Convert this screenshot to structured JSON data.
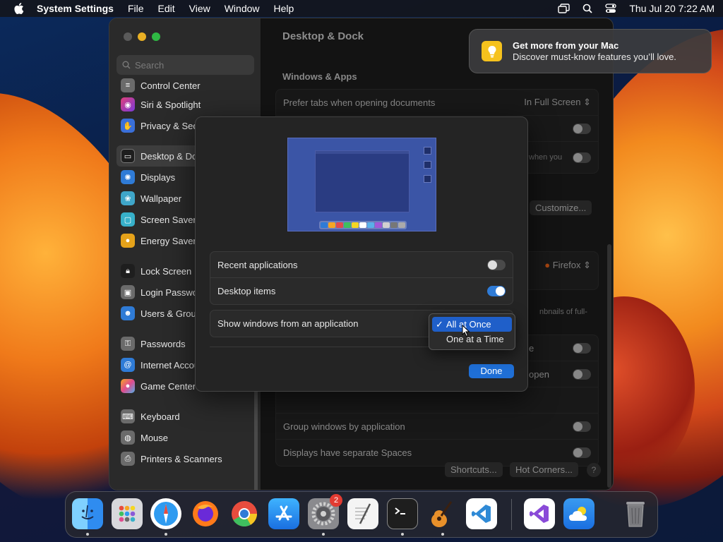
{
  "menubar": {
    "app_name": "System Settings",
    "items": [
      "File",
      "Edit",
      "View",
      "Window",
      "Help"
    ],
    "clock": "Thu Jul 20  7:22 AM"
  },
  "sidebar": {
    "search_placeholder": "Search",
    "items": [
      {
        "label": "Control Center",
        "icon": "control-center-icon",
        "color": "#6b6b6b"
      },
      {
        "label": "Siri & Spotlight",
        "icon": "siri-icon",
        "color": "#c0307a"
      },
      {
        "label": "Privacy & Security",
        "icon": "hand-icon",
        "color": "#3a6fd8"
      },
      {
        "label": "Desktop & Dock",
        "icon": "dock-icon",
        "color": "#1e1e1e"
      },
      {
        "label": "Displays",
        "icon": "sun-icon",
        "color": "#2f7bd6"
      },
      {
        "label": "Wallpaper",
        "icon": "flower-icon",
        "color": "#3fa6c9"
      },
      {
        "label": "Screen Saver",
        "icon": "screen-saver-icon",
        "color": "#37b0c9"
      },
      {
        "label": "Energy Saver",
        "icon": "bulb-icon",
        "color": "#e5a21a"
      },
      {
        "label": "Lock Screen",
        "icon": "lock-icon",
        "color": "#1e1e1e"
      },
      {
        "label": "Login Password",
        "icon": "lock-icon",
        "color": "#6b6b6b"
      },
      {
        "label": "Users & Groups",
        "icon": "users-icon",
        "color": "#2f7bd6"
      },
      {
        "label": "Passwords",
        "icon": "key-icon",
        "color": "#6b6b6b"
      },
      {
        "label": "Internet Accounts",
        "icon": "at-icon",
        "color": "#2f7bd6"
      },
      {
        "label": "Game Center",
        "icon": "game-center-icon",
        "color": "#e04c8e"
      },
      {
        "label": "Keyboard",
        "icon": "keyboard-icon",
        "color": "#6b6b6b"
      },
      {
        "label": "Mouse",
        "icon": "mouse-icon",
        "color": "#6b6b6b"
      },
      {
        "label": "Printers & Scanners",
        "icon": "printer-icon",
        "color": "#6b6b6b"
      }
    ]
  },
  "main": {
    "title": "Desktop & Dock",
    "section": "Windows & Apps",
    "prefer_tabs_label": "Prefer tabs when opening documents",
    "prefer_tabs_value": "In Full Screen",
    "when_you_fragment": "when you",
    "customize_label": "Customize...",
    "browser_value": "Firefox",
    "thumbnails_fragment": "nbnails of full-",
    "e_fragment": "e",
    "open_fragment": "open",
    "group_windows_label": "Group windows by application",
    "separate_spaces_label": "Displays have separate Spaces",
    "shortcuts_label": "Shortcuts...",
    "hot_corners_label": "Hot Corners...",
    "help_label": "?"
  },
  "sheet": {
    "recent_apps_label": "Recent applications",
    "desktop_items_label": "Desktop items",
    "show_windows_label": "Show windows from an application",
    "done_label": "Done",
    "options": [
      "All at Once",
      "One at a Time"
    ],
    "selected_option": "All at Once",
    "check_mark": "✓"
  },
  "notification": {
    "title": "Get more from your Mac",
    "body": "Discover must-know features you’ll love."
  },
  "dock": {
    "apps": [
      "Finder",
      "Launchpad",
      "Safari",
      "Firefox",
      "Chrome",
      "App Store",
      "System Settings",
      "TextEdit",
      "Terminal",
      "GarageBand",
      "Visual Studio Code",
      "Visual Studio",
      "Weather",
      "Trash"
    ],
    "system_settings_badge": "2"
  }
}
